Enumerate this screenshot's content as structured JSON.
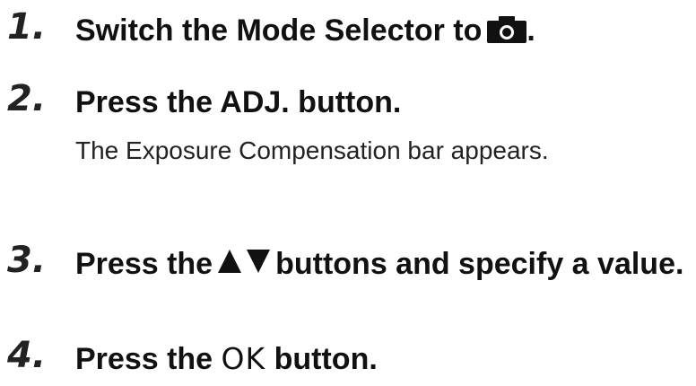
{
  "steps": [
    {
      "number": "1.",
      "text_before": "Switch the Mode Selector to",
      "icon": "camera-mode-icon",
      "text_after": "."
    },
    {
      "number": "2.",
      "text": "Press the ADJ. button.",
      "description": "The Exposure Compensation bar appears."
    },
    {
      "number": "3.",
      "text_before": "Press the",
      "icon": "up-down-arrows-icon",
      "text_after": "buttons and specify a value."
    },
    {
      "number": "4.",
      "text_before": "Press the",
      "button_label": "OK",
      "text_after": "button."
    }
  ]
}
